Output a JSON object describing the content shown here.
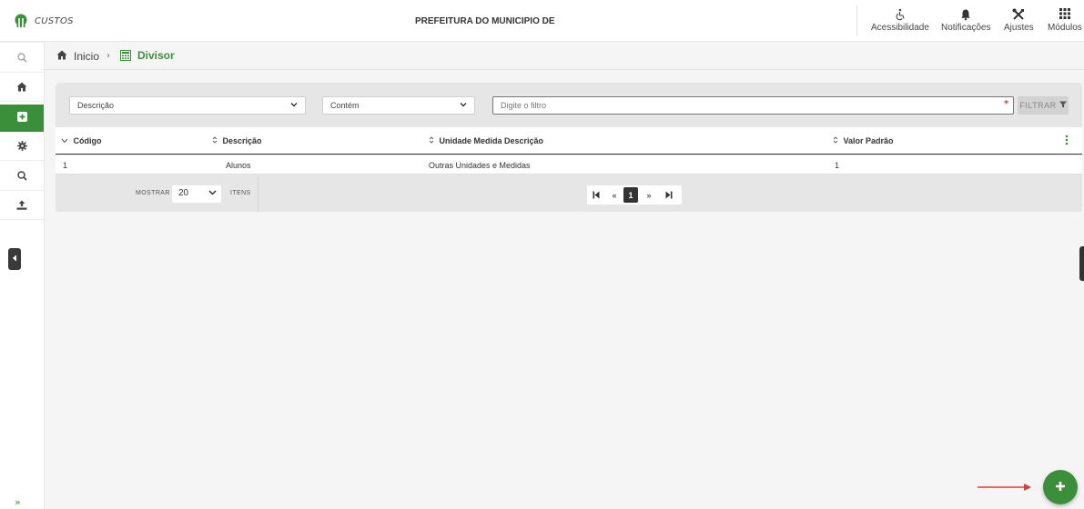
{
  "header": {
    "app_name": "CUSTOS",
    "organization": "PREFEITURA DO MUNICIPIO DE",
    "actions": [
      {
        "label": "Acessibilidade",
        "icon": "accessibility-icon"
      },
      {
        "label": "Notificações",
        "icon": "bell-icon"
      },
      {
        "label": "Ajustes",
        "icon": "tools-icon"
      },
      {
        "label": "Módulos",
        "icon": "grid-icon"
      }
    ]
  },
  "sidebar": {
    "items": [
      {
        "icon": "search-icon",
        "active": false
      },
      {
        "icon": "home-icon",
        "active": false
      },
      {
        "icon": "plus-square-icon",
        "active": true
      },
      {
        "icon": "gear-icon",
        "active": false
      },
      {
        "icon": "search-icon",
        "active": false
      },
      {
        "icon": "upload-icon",
        "active": false
      }
    ],
    "expand_label": "»"
  },
  "breadcrumb": {
    "home_label": "Inicio",
    "separator": "›",
    "current_label": "Divisor"
  },
  "filter": {
    "field_select": "Descrição",
    "operator_select": "Contém",
    "input_placeholder": "Digite o filtro",
    "required_mark": "*",
    "button_label": "FILTRAR"
  },
  "table": {
    "columns": [
      {
        "label": "Código",
        "sort_icon": "chevron-down-icon"
      },
      {
        "label": "Descrição",
        "sort_icon": "sort-icon"
      },
      {
        "label": "Unidade Medida Descrição",
        "sort_icon": "sort-icon"
      },
      {
        "label": "Valor Padrão",
        "sort_icon": "sort-icon"
      }
    ],
    "rows": [
      {
        "codigo": "1",
        "descricao": "Alunos",
        "unidade": "Outras Unidades e Medidas",
        "valor": "1"
      }
    ]
  },
  "pagination": {
    "show_label": "MOSTRAR",
    "per_page": "20",
    "items_label": "ITENS",
    "first": "K",
    "prev": "«",
    "current_page": "1",
    "next": "»",
    "last": "M"
  },
  "colors": {
    "accent": "#3c8f3a",
    "arrow": "#e53935"
  }
}
